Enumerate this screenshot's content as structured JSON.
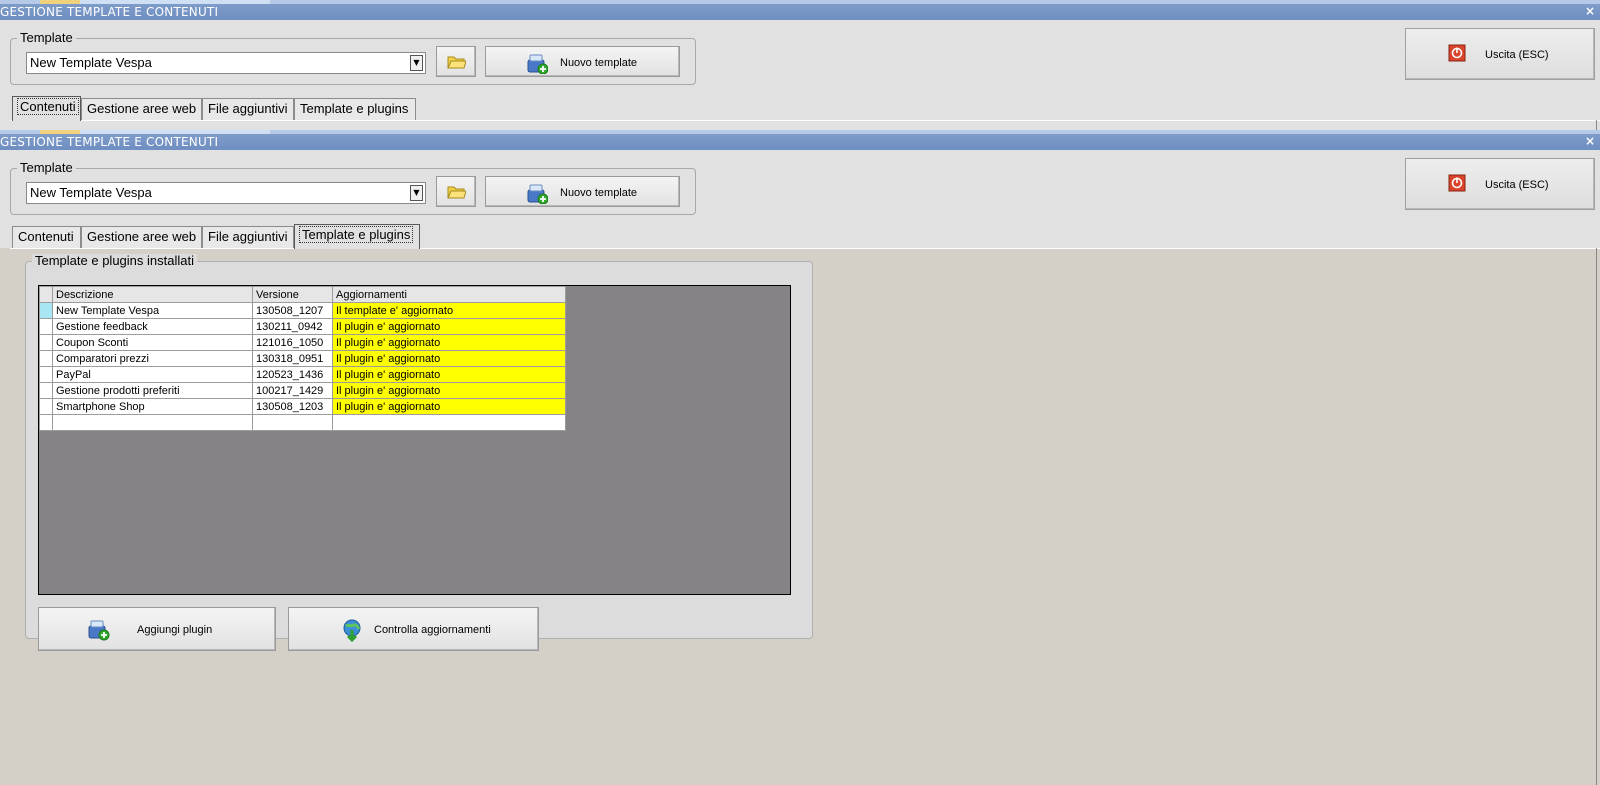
{
  "window": {
    "title": "GESTIONE TEMPLATE E CONTENUTI",
    "close_symbol": "×"
  },
  "template_group": {
    "legend": "Template",
    "selected_value": "New Template Vespa",
    "dropdown_icon": "chevron-down-icon",
    "folder_icon": "folder-icon",
    "new_template_label": "Nuovo template",
    "new_template_icon": "add-package-icon"
  },
  "exit_button": {
    "label": "Uscita (ESC)",
    "icon": "power-icon"
  },
  "tabs": [
    {
      "label": "Contenuti"
    },
    {
      "label": "Gestione aree web"
    },
    {
      "label": "File aggiuntivi"
    },
    {
      "label": "Template e plugins"
    }
  ],
  "window1_active_tab": "Contenuti",
  "window2_active_tab": "Template e plugins",
  "plugins_panel": {
    "legend": "Template e plugins installati",
    "columns": [
      "Descrizione",
      "Versione",
      "Aggiornamenti"
    ],
    "rows": [
      {
        "descrizione": "New Template Vespa",
        "versione": "130508_1207",
        "aggiornamenti": "Il template e' aggiornato"
      },
      {
        "descrizione": "Gestione feedback",
        "versione": "130211_0942",
        "aggiornamenti": "Il plugin e' aggiornato"
      },
      {
        "descrizione": "Coupon Sconti",
        "versione": "121016_1050",
        "aggiornamenti": "Il plugin e' aggiornato"
      },
      {
        "descrizione": "Comparatori prezzi",
        "versione": "130318_0951",
        "aggiornamenti": "Il plugin e' aggiornato"
      },
      {
        "descrizione": "PayPal",
        "versione": "120523_1436",
        "aggiornamenti": "Il plugin e' aggiornato"
      },
      {
        "descrizione": "Gestione prodotti preferiti",
        "versione": "100217_1429",
        "aggiornamenti": "Il plugin e' aggiornato"
      },
      {
        "descrizione": "Smartphone Shop",
        "versione": "130508_1203",
        "aggiornamenti": "Il plugin e' aggiornato"
      }
    ],
    "add_plugin_label": "Aggiungi plugin",
    "add_plugin_icon": "add-package-icon",
    "check_updates_label": "Controlla aggiornamenti",
    "check_updates_icon": "globe-download-icon"
  },
  "colors": {
    "titlebar": "#6f8ec1",
    "update_highlight": "#ffff00",
    "grid_background": "#868386",
    "selected_row_marker": "#a7e6f2"
  }
}
